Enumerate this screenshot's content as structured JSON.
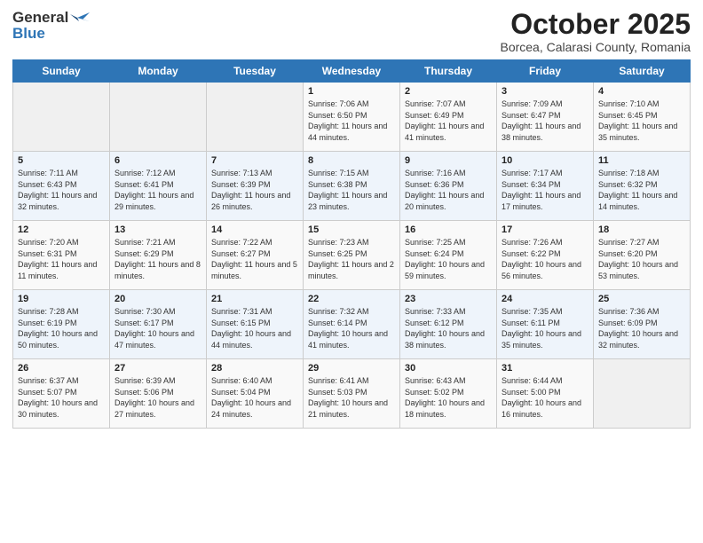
{
  "header": {
    "logo_line1": "General",
    "logo_line2": "Blue",
    "month": "October 2025",
    "location": "Borcea, Calarasi County, Romania"
  },
  "days_of_week": [
    "Sunday",
    "Monday",
    "Tuesday",
    "Wednesday",
    "Thursday",
    "Friday",
    "Saturday"
  ],
  "weeks": [
    [
      {
        "num": "",
        "info": ""
      },
      {
        "num": "",
        "info": ""
      },
      {
        "num": "",
        "info": ""
      },
      {
        "num": "1",
        "info": "Sunrise: 7:06 AM\nSunset: 6:50 PM\nDaylight: 11 hours and 44 minutes."
      },
      {
        "num": "2",
        "info": "Sunrise: 7:07 AM\nSunset: 6:49 PM\nDaylight: 11 hours and 41 minutes."
      },
      {
        "num": "3",
        "info": "Sunrise: 7:09 AM\nSunset: 6:47 PM\nDaylight: 11 hours and 38 minutes."
      },
      {
        "num": "4",
        "info": "Sunrise: 7:10 AM\nSunset: 6:45 PM\nDaylight: 11 hours and 35 minutes."
      }
    ],
    [
      {
        "num": "5",
        "info": "Sunrise: 7:11 AM\nSunset: 6:43 PM\nDaylight: 11 hours and 32 minutes."
      },
      {
        "num": "6",
        "info": "Sunrise: 7:12 AM\nSunset: 6:41 PM\nDaylight: 11 hours and 29 minutes."
      },
      {
        "num": "7",
        "info": "Sunrise: 7:13 AM\nSunset: 6:39 PM\nDaylight: 11 hours and 26 minutes."
      },
      {
        "num": "8",
        "info": "Sunrise: 7:15 AM\nSunset: 6:38 PM\nDaylight: 11 hours and 23 minutes."
      },
      {
        "num": "9",
        "info": "Sunrise: 7:16 AM\nSunset: 6:36 PM\nDaylight: 11 hours and 20 minutes."
      },
      {
        "num": "10",
        "info": "Sunrise: 7:17 AM\nSunset: 6:34 PM\nDaylight: 11 hours and 17 minutes."
      },
      {
        "num": "11",
        "info": "Sunrise: 7:18 AM\nSunset: 6:32 PM\nDaylight: 11 hours and 14 minutes."
      }
    ],
    [
      {
        "num": "12",
        "info": "Sunrise: 7:20 AM\nSunset: 6:31 PM\nDaylight: 11 hours and 11 minutes."
      },
      {
        "num": "13",
        "info": "Sunrise: 7:21 AM\nSunset: 6:29 PM\nDaylight: 11 hours and 8 minutes."
      },
      {
        "num": "14",
        "info": "Sunrise: 7:22 AM\nSunset: 6:27 PM\nDaylight: 11 hours and 5 minutes."
      },
      {
        "num": "15",
        "info": "Sunrise: 7:23 AM\nSunset: 6:25 PM\nDaylight: 11 hours and 2 minutes."
      },
      {
        "num": "16",
        "info": "Sunrise: 7:25 AM\nSunset: 6:24 PM\nDaylight: 10 hours and 59 minutes."
      },
      {
        "num": "17",
        "info": "Sunrise: 7:26 AM\nSunset: 6:22 PM\nDaylight: 10 hours and 56 minutes."
      },
      {
        "num": "18",
        "info": "Sunrise: 7:27 AM\nSunset: 6:20 PM\nDaylight: 10 hours and 53 minutes."
      }
    ],
    [
      {
        "num": "19",
        "info": "Sunrise: 7:28 AM\nSunset: 6:19 PM\nDaylight: 10 hours and 50 minutes."
      },
      {
        "num": "20",
        "info": "Sunrise: 7:30 AM\nSunset: 6:17 PM\nDaylight: 10 hours and 47 minutes."
      },
      {
        "num": "21",
        "info": "Sunrise: 7:31 AM\nSunset: 6:15 PM\nDaylight: 10 hours and 44 minutes."
      },
      {
        "num": "22",
        "info": "Sunrise: 7:32 AM\nSunset: 6:14 PM\nDaylight: 10 hours and 41 minutes."
      },
      {
        "num": "23",
        "info": "Sunrise: 7:33 AM\nSunset: 6:12 PM\nDaylight: 10 hours and 38 minutes."
      },
      {
        "num": "24",
        "info": "Sunrise: 7:35 AM\nSunset: 6:11 PM\nDaylight: 10 hours and 35 minutes."
      },
      {
        "num": "25",
        "info": "Sunrise: 7:36 AM\nSunset: 6:09 PM\nDaylight: 10 hours and 32 minutes."
      }
    ],
    [
      {
        "num": "26",
        "info": "Sunrise: 6:37 AM\nSunset: 5:07 PM\nDaylight: 10 hours and 30 minutes."
      },
      {
        "num": "27",
        "info": "Sunrise: 6:39 AM\nSunset: 5:06 PM\nDaylight: 10 hours and 27 minutes."
      },
      {
        "num": "28",
        "info": "Sunrise: 6:40 AM\nSunset: 5:04 PM\nDaylight: 10 hours and 24 minutes."
      },
      {
        "num": "29",
        "info": "Sunrise: 6:41 AM\nSunset: 5:03 PM\nDaylight: 10 hours and 21 minutes."
      },
      {
        "num": "30",
        "info": "Sunrise: 6:43 AM\nSunset: 5:02 PM\nDaylight: 10 hours and 18 minutes."
      },
      {
        "num": "31",
        "info": "Sunrise: 6:44 AM\nSunset: 5:00 PM\nDaylight: 10 hours and 16 minutes."
      },
      {
        "num": "",
        "info": ""
      }
    ]
  ]
}
